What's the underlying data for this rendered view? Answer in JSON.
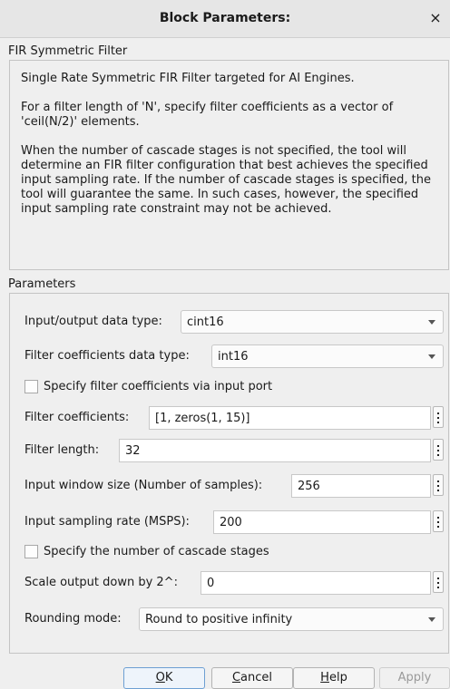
{
  "window": {
    "title": "Block Parameters:",
    "close_glyph": "×"
  },
  "block": {
    "name": "FIR Symmetric Filter",
    "description": [
      "Single Rate Symmetric FIR Filter targeted for AI Engines.",
      "For a filter length of 'N', specify filter coefficients as a vector of 'ceil(N/2)' elements.",
      "When the number of cascade stages is not specified, the tool will determine an FIR filter configuration that best achieves the specified input sampling rate. If the number of cascade stages is specified, the tool will guarantee the same. In such cases, however, the specified input sampling rate constraint may not be achieved."
    ]
  },
  "params": {
    "group_label": "Parameters",
    "io_type": {
      "label": "Input/output data type:",
      "value": "cint16"
    },
    "coef_type": {
      "label": "Filter coefficients data type:",
      "value": "int16"
    },
    "coef_port": {
      "label": "Specify filter coefficients via input port",
      "checked": false
    },
    "coefficients": {
      "label": "Filter coefficients:",
      "value": "[1, zeros(1, 15)]"
    },
    "length": {
      "label": "Filter length:",
      "value": "32"
    },
    "window_size": {
      "label": "Input window size (Number of samples):",
      "value": "256"
    },
    "sampling_rate": {
      "label": "Input sampling rate (MSPS):",
      "value": "200"
    },
    "cascade": {
      "label": "Specify the number of cascade stages",
      "checked": false
    },
    "scale": {
      "label": "Scale output down by 2^:",
      "value": "0"
    },
    "rounding": {
      "label": "Rounding mode:",
      "value": "Round to positive infinity"
    }
  },
  "buttons": {
    "ok_u": "O",
    "ok_rest": "K",
    "cancel_u": "C",
    "cancel_rest": "ancel",
    "help_u": "H",
    "help_rest": "elp",
    "apply": "Apply"
  }
}
